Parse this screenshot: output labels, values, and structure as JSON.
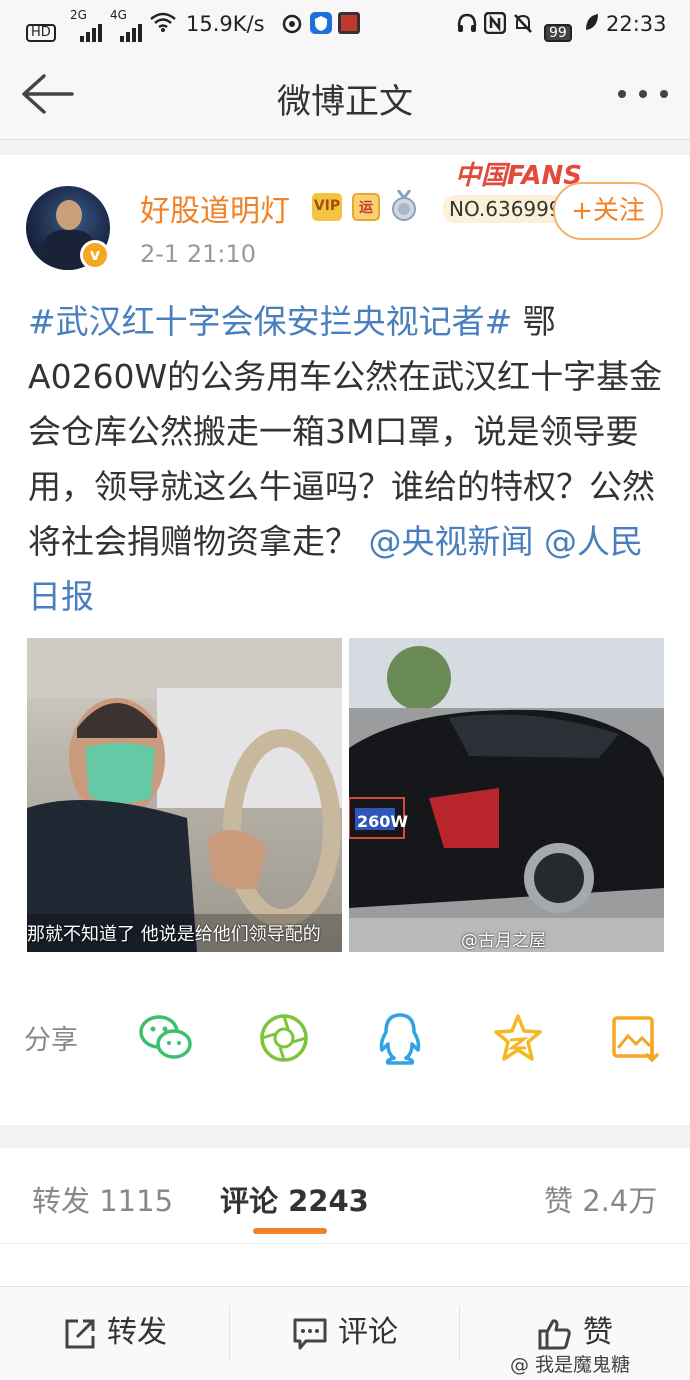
{
  "status_bar": {
    "hd": "HD",
    "net1": "2G",
    "net2": "4G",
    "speed": "15.9K/s",
    "battery": "99",
    "time": "22:33"
  },
  "nav": {
    "back_icon": "back-arrow-icon",
    "title": "微博正文",
    "more_icon": "more-dots-icon"
  },
  "post": {
    "username": "好股道明灯",
    "vip_badge": "VIP",
    "badge_yun": "运",
    "timestamp": "2-1 21:10",
    "fans_title": "中国FANS",
    "fans_no": "NO.636999",
    "follow_label": "+关注",
    "topic": "#武汉红十字会保安拦央视记者#",
    "text": " 鄂A0260W的公务用车公然在武汉红十字基金会仓库公然搬走一箱3M口罩，说是领导要用，领导就这么牛逼吗？谁给的特权？公然将社会捐赠物资拿走？",
    "mention1": "@央视新闻",
    "mention2": "@人民日报",
    "photo1_caption": "那就不知道了 他说是给他们领导配的",
    "photo2_plate": "260W",
    "photo2_watermark": "@古月之屋"
  },
  "share": {
    "label": "分享",
    "icons": [
      "wechat-icon",
      "moments-icon",
      "qq-icon",
      "qzone-icon",
      "save-image-icon"
    ]
  },
  "tabs": {
    "repost": "转发 1115",
    "comments": "评论 2243",
    "likes": "赞 2.4万"
  },
  "bottom_bar": {
    "repost_label": "转发",
    "comment_label": "评论",
    "like_label": "赞"
  },
  "watermark": "@ 我是魔鬼糖",
  "colors": {
    "accent": "#f08228",
    "link": "#4a7fbf",
    "muted": "#999999"
  }
}
